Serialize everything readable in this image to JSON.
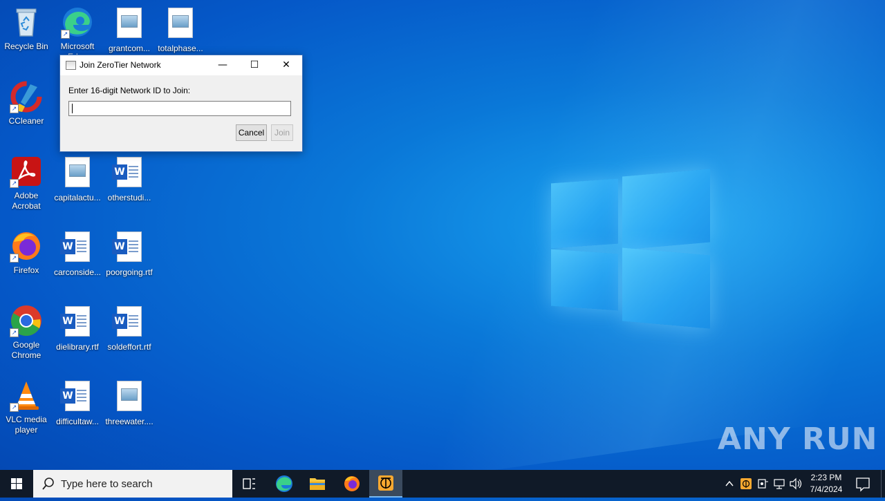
{
  "desktop": {
    "icons": [
      {
        "label": "Recycle Bin"
      },
      {
        "label": "Microsoft Edge"
      },
      {
        "label": "grantcom..."
      },
      {
        "label": "totalphase..."
      },
      {
        "label": "CCleaner"
      },
      {
        "label": "Adobe Acrobat"
      },
      {
        "label": "capitalactu..."
      },
      {
        "label": "otherstudi..."
      },
      {
        "label": "Firefox"
      },
      {
        "label": "carconside..."
      },
      {
        "label": "poorgoing.rtf"
      },
      {
        "label": "Google Chrome"
      },
      {
        "label": "dielibrary.rtf"
      },
      {
        "label": "soldeffort.rtf"
      },
      {
        "label": "VLC media player"
      },
      {
        "label": "difficultaw..."
      },
      {
        "label": "threewater...."
      }
    ],
    "watermark": "ANY RUN"
  },
  "dialog": {
    "title": "Join ZeroTier Network",
    "prompt": "Enter 16-digit Network ID to Join:",
    "input_value": "",
    "cancel_label": "Cancel",
    "join_label": "Join",
    "minimize_glyph": "—",
    "maximize_glyph": "☐",
    "close_glyph": "✕"
  },
  "taskbar": {
    "search_placeholder": "Type here to search",
    "time": "2:23 PM",
    "date": "7/4/2024"
  },
  "colors": {
    "accent": "#0a78d8",
    "taskbar": "#101a28",
    "active_app": "#3a4a5e"
  }
}
